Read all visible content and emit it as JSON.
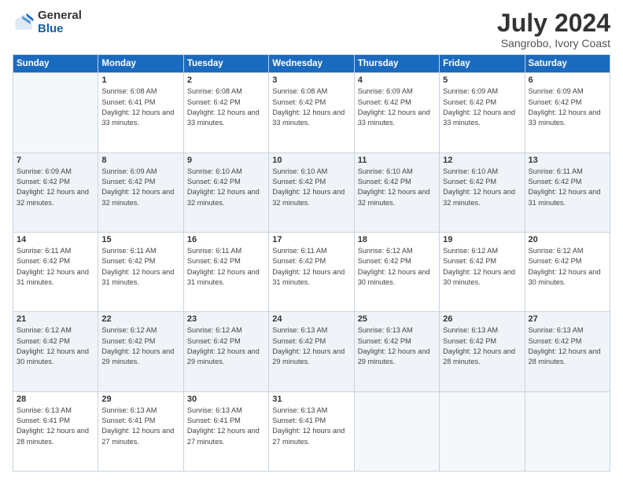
{
  "logo": {
    "general": "General",
    "blue": "Blue"
  },
  "header": {
    "title": "July 2024",
    "subtitle": "Sangrobo, Ivory Coast"
  },
  "weekdays": [
    "Sunday",
    "Monday",
    "Tuesday",
    "Wednesday",
    "Thursday",
    "Friday",
    "Saturday"
  ],
  "weeks": [
    [
      {
        "day": "",
        "info": ""
      },
      {
        "day": "1",
        "info": "Sunrise: 6:08 AM\nSunset: 6:41 PM\nDaylight: 12 hours\nand 33 minutes."
      },
      {
        "day": "2",
        "info": "Sunrise: 6:08 AM\nSunset: 6:42 PM\nDaylight: 12 hours\nand 33 minutes."
      },
      {
        "day": "3",
        "info": "Sunrise: 6:08 AM\nSunset: 6:42 PM\nDaylight: 12 hours\nand 33 minutes."
      },
      {
        "day": "4",
        "info": "Sunrise: 6:09 AM\nSunset: 6:42 PM\nDaylight: 12 hours\nand 33 minutes."
      },
      {
        "day": "5",
        "info": "Sunrise: 6:09 AM\nSunset: 6:42 PM\nDaylight: 12 hours\nand 33 minutes."
      },
      {
        "day": "6",
        "info": "Sunrise: 6:09 AM\nSunset: 6:42 PM\nDaylight: 12 hours\nand 33 minutes."
      }
    ],
    [
      {
        "day": "7",
        "info": "Sunrise: 6:09 AM\nSunset: 6:42 PM\nDaylight: 12 hours\nand 32 minutes."
      },
      {
        "day": "8",
        "info": "Sunrise: 6:09 AM\nSunset: 6:42 PM\nDaylight: 12 hours\nand 32 minutes."
      },
      {
        "day": "9",
        "info": "Sunrise: 6:10 AM\nSunset: 6:42 PM\nDaylight: 12 hours\nand 32 minutes."
      },
      {
        "day": "10",
        "info": "Sunrise: 6:10 AM\nSunset: 6:42 PM\nDaylight: 12 hours\nand 32 minutes."
      },
      {
        "day": "11",
        "info": "Sunrise: 6:10 AM\nSunset: 6:42 PM\nDaylight: 12 hours\nand 32 minutes."
      },
      {
        "day": "12",
        "info": "Sunrise: 6:10 AM\nSunset: 6:42 PM\nDaylight: 12 hours\nand 32 minutes."
      },
      {
        "day": "13",
        "info": "Sunrise: 6:11 AM\nSunset: 6:42 PM\nDaylight: 12 hours\nand 31 minutes."
      }
    ],
    [
      {
        "day": "14",
        "info": "Sunrise: 6:11 AM\nSunset: 6:42 PM\nDaylight: 12 hours\nand 31 minutes."
      },
      {
        "day": "15",
        "info": "Sunrise: 6:11 AM\nSunset: 6:42 PM\nDaylight: 12 hours\nand 31 minutes."
      },
      {
        "day": "16",
        "info": "Sunrise: 6:11 AM\nSunset: 6:42 PM\nDaylight: 12 hours\nand 31 minutes."
      },
      {
        "day": "17",
        "info": "Sunrise: 6:11 AM\nSunset: 6:42 PM\nDaylight: 12 hours\nand 31 minutes."
      },
      {
        "day": "18",
        "info": "Sunrise: 6:12 AM\nSunset: 6:42 PM\nDaylight: 12 hours\nand 30 minutes."
      },
      {
        "day": "19",
        "info": "Sunrise: 6:12 AM\nSunset: 6:42 PM\nDaylight: 12 hours\nand 30 minutes."
      },
      {
        "day": "20",
        "info": "Sunrise: 6:12 AM\nSunset: 6:42 PM\nDaylight: 12 hours\nand 30 minutes."
      }
    ],
    [
      {
        "day": "21",
        "info": "Sunrise: 6:12 AM\nSunset: 6:42 PM\nDaylight: 12 hours\nand 30 minutes."
      },
      {
        "day": "22",
        "info": "Sunrise: 6:12 AM\nSunset: 6:42 PM\nDaylight: 12 hours\nand 29 minutes."
      },
      {
        "day": "23",
        "info": "Sunrise: 6:12 AM\nSunset: 6:42 PM\nDaylight: 12 hours\nand 29 minutes."
      },
      {
        "day": "24",
        "info": "Sunrise: 6:13 AM\nSunset: 6:42 PM\nDaylight: 12 hours\nand 29 minutes."
      },
      {
        "day": "25",
        "info": "Sunrise: 6:13 AM\nSunset: 6:42 PM\nDaylight: 12 hours\nand 29 minutes."
      },
      {
        "day": "26",
        "info": "Sunrise: 6:13 AM\nSunset: 6:42 PM\nDaylight: 12 hours\nand 28 minutes."
      },
      {
        "day": "27",
        "info": "Sunrise: 6:13 AM\nSunset: 6:42 PM\nDaylight: 12 hours\nand 28 minutes."
      }
    ],
    [
      {
        "day": "28",
        "info": "Sunrise: 6:13 AM\nSunset: 6:41 PM\nDaylight: 12 hours\nand 28 minutes."
      },
      {
        "day": "29",
        "info": "Sunrise: 6:13 AM\nSunset: 6:41 PM\nDaylight: 12 hours\nand 27 minutes."
      },
      {
        "day": "30",
        "info": "Sunrise: 6:13 AM\nSunset: 6:41 PM\nDaylight: 12 hours\nand 27 minutes."
      },
      {
        "day": "31",
        "info": "Sunrise: 6:13 AM\nSunset: 6:41 PM\nDaylight: 12 hours\nand 27 minutes."
      },
      {
        "day": "",
        "info": ""
      },
      {
        "day": "",
        "info": ""
      },
      {
        "day": "",
        "info": ""
      }
    ]
  ],
  "row_shades": [
    false,
    true,
    false,
    true,
    false
  ]
}
